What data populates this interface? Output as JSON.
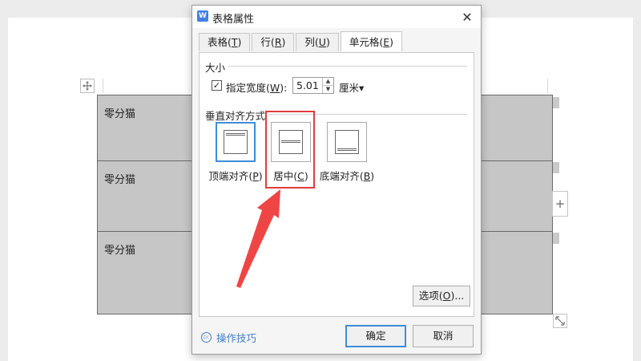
{
  "document": {
    "cells": [
      "零分猫",
      "零分猫",
      "零分猫"
    ],
    "move_handle_icon": "move-arrows-icon",
    "add_column_symbol": "+",
    "resize_icon": "resize-icon"
  },
  "dialog": {
    "title": "表格属性",
    "app_icon_letter": "W",
    "close_symbol": "✕",
    "tabs": [
      {
        "label": "表格(T)",
        "text": "表格(",
        "key": "T",
        "end": ")"
      },
      {
        "label": "行(R)",
        "text": "行(",
        "key": "R",
        "end": ")"
      },
      {
        "label": "列(U)",
        "text": "列(",
        "key": "U",
        "end": ")"
      },
      {
        "label": "单元格(E)",
        "text": "单元格(",
        "key": "E",
        "end": ")",
        "active": true
      }
    ],
    "size_group": {
      "label": "大小",
      "specify_width_checked": true,
      "check_mark": "✓",
      "width_label_text": "指定宽度(",
      "width_label_key": "W",
      "width_label_end": "):",
      "width_value": "5.01",
      "unit": "厘米",
      "unit_arrow": "▾"
    },
    "vertical_align": {
      "label": "垂直对齐方式",
      "options": [
        {
          "label_text": "顶端对齐(",
          "key": "P",
          "end": ")",
          "selected": true
        },
        {
          "label_text": "居中(",
          "key": "C",
          "end": ")",
          "selected": false
        },
        {
          "label_text": "底端对齐(",
          "key": "B",
          "end": ")",
          "selected": false
        }
      ]
    },
    "options_button": {
      "text": "选项(",
      "key": "O",
      "end": ")..."
    },
    "tips_link": "操作技巧",
    "tips_icon_symbol": "▷",
    "ok_label": "确定",
    "cancel_label": "取消"
  },
  "colors": {
    "highlight": "#e23b3b",
    "accent": "#3e8ed8",
    "cell_fill": "#c6c6c6"
  }
}
